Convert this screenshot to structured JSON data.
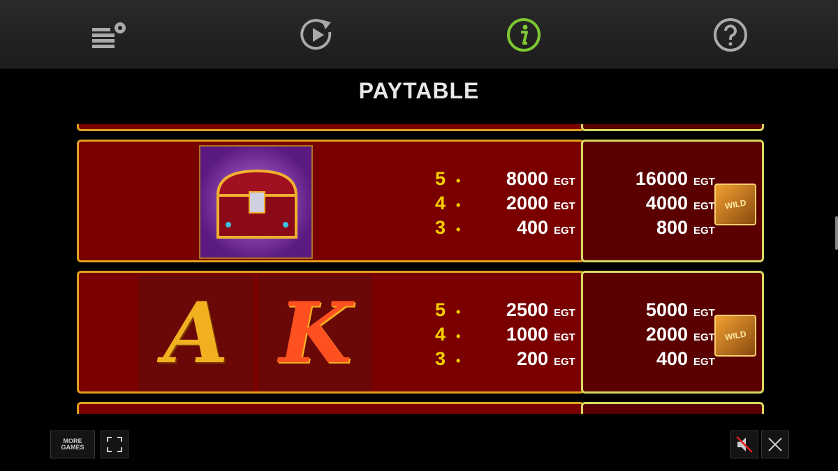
{
  "colors": {
    "accent": "#7dc832",
    "cell_bg": "#7a0000",
    "cell_border": "#e0a020",
    "wild_border": "#d8d860"
  },
  "toolbar": {
    "items": [
      {
        "icon": "settings-stack-icon"
      },
      {
        "icon": "autoplay-icon"
      },
      {
        "icon": "info-icon",
        "active": true
      },
      {
        "icon": "help-icon"
      }
    ]
  },
  "page": {
    "title": "PAYTABLE"
  },
  "paytable": {
    "rows": [
      {
        "symbols": [
          "treasure-chest"
        ],
        "pays": [
          {
            "count": "5",
            "amount": "8000",
            "currency": "EGT"
          },
          {
            "count": "4",
            "amount": "2000",
            "currency": "EGT"
          },
          {
            "count": "3",
            "amount": "400",
            "currency": "EGT"
          }
        ],
        "wild_pays": [
          {
            "amount": "16000",
            "currency": "EGT"
          },
          {
            "amount": "4000",
            "currency": "EGT"
          },
          {
            "amount": "800",
            "currency": "EGT"
          }
        ],
        "wild_icon_label": "WILD"
      },
      {
        "symbols": [
          "A",
          "K"
        ],
        "pays": [
          {
            "count": "5",
            "amount": "2500",
            "currency": "EGT"
          },
          {
            "count": "4",
            "amount": "1000",
            "currency": "EGT"
          },
          {
            "count": "3",
            "amount": "200",
            "currency": "EGT"
          }
        ],
        "wild_pays": [
          {
            "amount": "5000",
            "currency": "EGT"
          },
          {
            "amount": "2000",
            "currency": "EGT"
          },
          {
            "amount": "400",
            "currency": "EGT"
          }
        ],
        "wild_icon_label": "WILD"
      }
    ]
  },
  "footer": {
    "more_games_line1": "MORE",
    "more_games_line2": "GAMES"
  }
}
